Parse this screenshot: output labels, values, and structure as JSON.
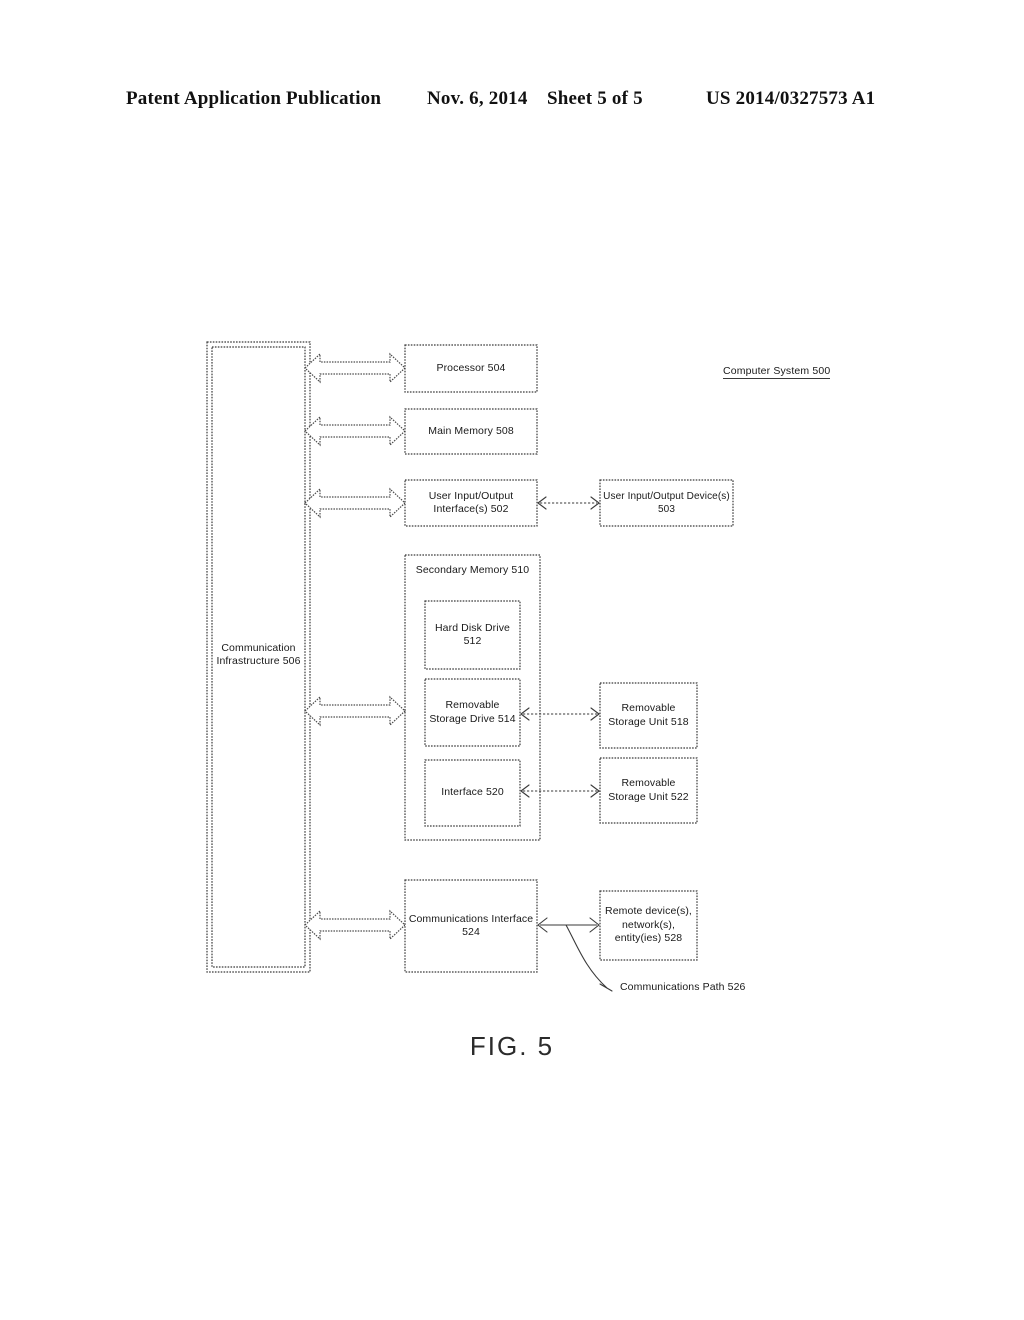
{
  "header": {
    "publication": "Patent Application Publication",
    "date": "Nov. 6, 2014",
    "sheet": "Sheet 5 of 5",
    "patent_number": "US 2014/0327573 A1"
  },
  "figure": {
    "caption": "FIG. 5",
    "system_label": "Computer System 500",
    "comm_path_label": "Communications Path 526",
    "bus": {
      "label_line1": "Communication",
      "label_line2": "Infrastructure 506"
    },
    "blocks": {
      "processor": "Processor 504",
      "main_memory": "Main Memory 508",
      "user_io_interface_l1": "User Input/Output",
      "user_io_interface_l2": "Interface(s) 502",
      "user_io_device_l1": "User Input/Output Device(s)",
      "user_io_device_l2": "503",
      "secondary_memory": "Secondary Memory 510",
      "hard_disk_drive_l1": "Hard Disk Drive",
      "hard_disk_drive_l2": "512",
      "removable_storage_drive_l1": "Removable",
      "removable_storage_drive_l2": "Storage Drive 514",
      "removable_storage_unit_518_l1": "Removable",
      "removable_storage_unit_518_l2": "Storage Unit 518",
      "interface_520": "Interface 520",
      "removable_storage_unit_522_l1": "Removable",
      "removable_storage_unit_522_l2": "Storage Unit 522",
      "communications_interface_l1": "Communications Interface",
      "communications_interface_l2": "524",
      "remote_devices_l1": "Remote device(s),",
      "remote_devices_l2": "network(s),",
      "remote_devices_l3": "entity(ies) 528"
    }
  },
  "colors": {
    "ink": "#1a1a1a",
    "line": "#3a3a3a",
    "page": "#ffffff"
  }
}
